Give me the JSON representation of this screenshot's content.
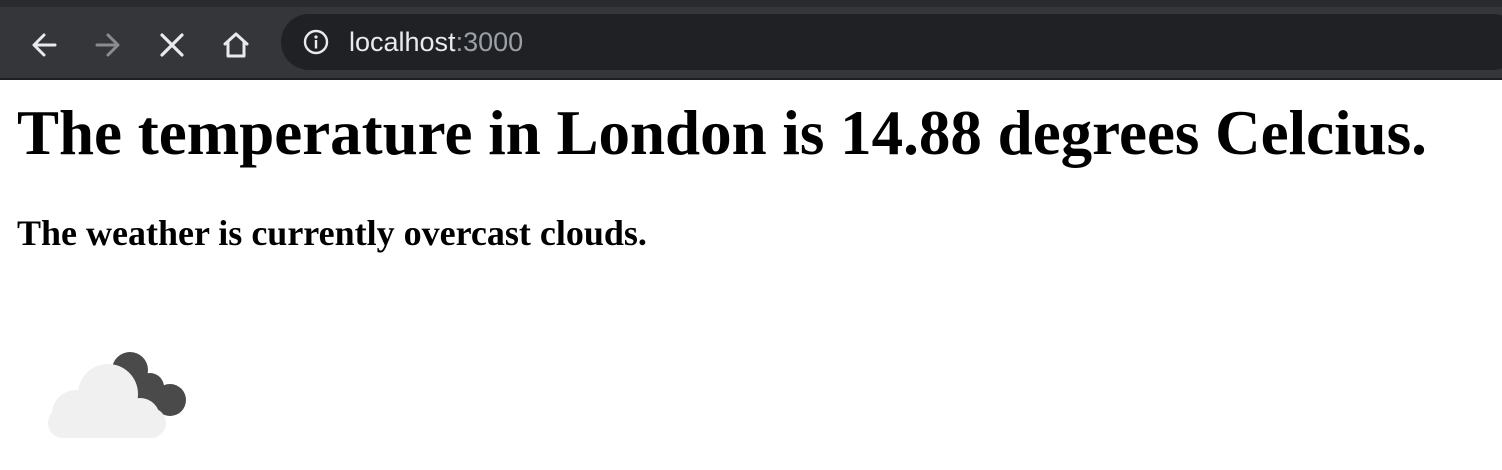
{
  "browser": {
    "url_host": "localhost",
    "url_port": ":3000",
    "back_icon": "arrow-left-icon",
    "forward_icon": "arrow-right-icon",
    "stop_icon": "close-icon",
    "home_icon": "home-icon",
    "site_info_icon": "info-icon"
  },
  "page": {
    "temperature_heading": "The temperature in London is 14.88 degrees Celcius.",
    "weather_description": "The weather is currently overcast clouds.",
    "weather_icon": "overcast-clouds-icon"
  }
}
